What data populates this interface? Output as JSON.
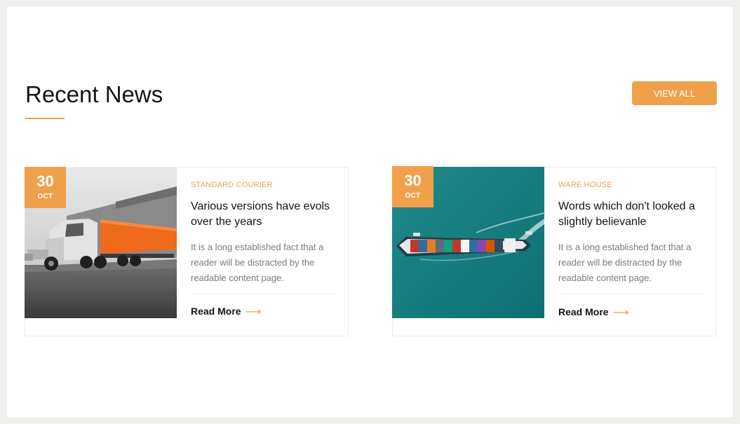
{
  "section": {
    "title": "Recent News",
    "view_all_label": "VIEW ALL"
  },
  "theme": {
    "accent": "#f0a04b",
    "heading": "#141414",
    "body_text": "#7a7a7a"
  },
  "articles": [
    {
      "date_day": "30",
      "date_month": "OCT",
      "category": "STANDARD COURIER",
      "title": "Various versions have evols over the years",
      "excerpt": "It is a long established fact that a reader will be distracted by the readable content page.",
      "read_more_label": "Read More",
      "image_icon": "truck-image"
    },
    {
      "date_day": "30",
      "date_month": "OCT",
      "category": "WARE HOUSE",
      "title": "Words which don't looked a slightly believanle",
      "excerpt": "It is a long established fact that a reader will be distracted by the readable content page.",
      "read_more_label": "Read More",
      "image_icon": "cargo-ship-image"
    }
  ]
}
